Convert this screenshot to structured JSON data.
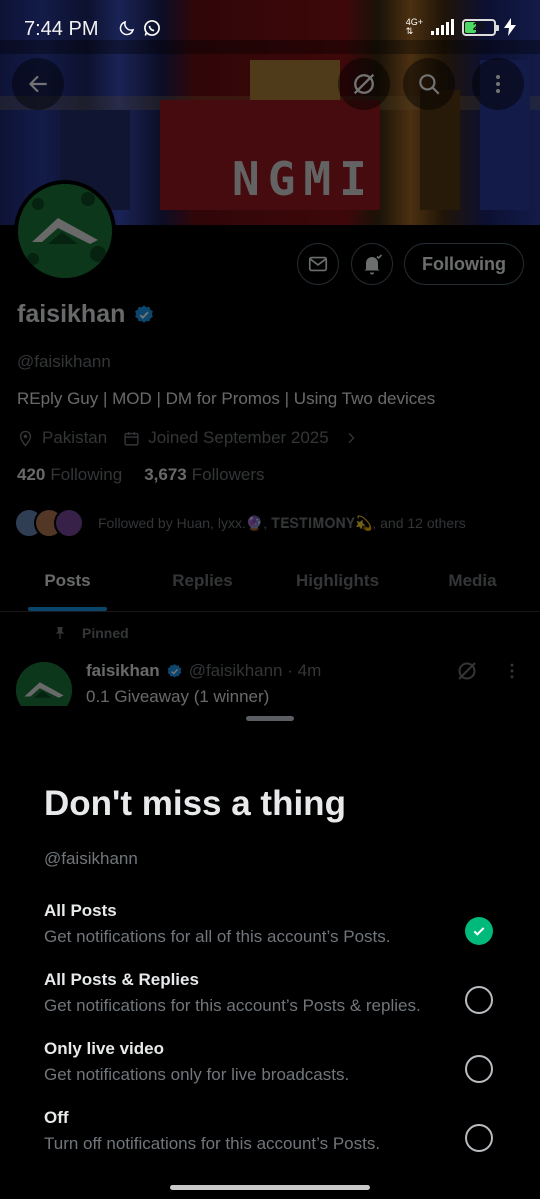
{
  "status_bar": {
    "time": "7:44 PM",
    "network": "4G+",
    "battery": "25"
  },
  "banner": {
    "text": "NGMI"
  },
  "profile": {
    "name": "faisikhan",
    "handle": "@faisikhann",
    "bio": "REply Guy | MOD | DM for Promos | Using Two devices",
    "location": "Pakistan",
    "joined": "Joined September 2025",
    "following_count": "420",
    "following_label": "Following",
    "followers_count": "3,673",
    "followers_label": "Followers",
    "followed_by": "Followed by Huan, lyxx.🔮, 𝐓𝐄𝐒𝐓𝐈𝐌𝐎𝐍𝐘💫, and 12 others",
    "following_button": "Following"
  },
  "tabs": [
    "Posts",
    "Replies",
    "Highlights",
    "Media"
  ],
  "active_tab": "Posts",
  "pinned_post": {
    "pinned_label": "Pinned",
    "author": "faisikhan",
    "handle_time": "@faisikhann · 4m",
    "text": "0.1 Giveaway (1 winner)"
  },
  "sheet": {
    "title": "Don't miss a thing",
    "handle": "@faisikhann",
    "options": [
      {
        "title": "All Posts",
        "desc": "Get notifications for all of this account’s Posts.",
        "selected": true
      },
      {
        "title": "All Posts & Replies",
        "desc": "Get notifications for this account’s Posts & replies.",
        "selected": false
      },
      {
        "title": "Only live video",
        "desc": "Get notifications only for live broadcasts.",
        "selected": false
      },
      {
        "title": "Off",
        "desc": "Turn off notifications for this account’s Posts.",
        "selected": false
      }
    ]
  },
  "colors": {
    "accent": "#1d9bf0",
    "selected": "#00ba7c",
    "muted": "#71767b"
  },
  "icons": [
    "back-arrow-icon",
    "grok-icon",
    "search-icon",
    "more-vertical-icon",
    "mail-icon",
    "bell-check-icon",
    "verified-badge-icon",
    "location-icon",
    "calendar-icon",
    "chevron-right-icon",
    "pin-icon",
    "check-icon"
  ]
}
